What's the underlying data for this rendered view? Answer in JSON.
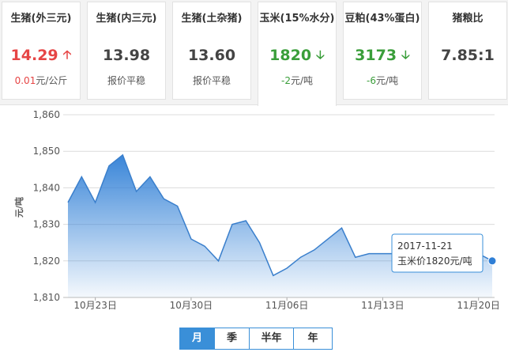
{
  "cards": [
    {
      "title": "生猪(外三元)",
      "price": "14.29",
      "trend": "up",
      "change_amount": "0.01",
      "change_unit": "元/公斤",
      "change_text": ""
    },
    {
      "title": "生猪(内三元)",
      "price": "13.98",
      "trend": "flat",
      "change_amount": "",
      "change_unit": "",
      "change_text": "报价平稳"
    },
    {
      "title": "生猪(土杂猪)",
      "price": "13.60",
      "trend": "flat",
      "change_amount": "",
      "change_unit": "",
      "change_text": "报价平稳"
    },
    {
      "title": "玉米(15%水分)",
      "price": "1820",
      "trend": "down",
      "change_amount": "-2",
      "change_unit": "元/吨",
      "change_text": ""
    },
    {
      "title": "豆粕(43%蛋白)",
      "price": "3173",
      "trend": "down",
      "change_amount": "-6",
      "change_unit": "元/吨",
      "change_text": ""
    },
    {
      "title": "猪粮比",
      "price": "7.85:1",
      "trend": "flat",
      "change_amount": "",
      "change_unit": "",
      "change_text": ""
    }
  ],
  "active_card": 3,
  "colors": {
    "up": "#e64545",
    "down": "#3a9e3a",
    "accent": "#3a8fd8"
  },
  "chart_data": {
    "type": "area",
    "ylabel": "元/吨",
    "ylim": [
      1810,
      1860
    ],
    "yticks": [
      1810,
      1820,
      1830,
      1840,
      1850,
      1860
    ],
    "ytick_labels": [
      "1,810",
      "1,820",
      "1,830",
      "1,840",
      "1,850",
      "1,860"
    ],
    "x": [
      "10-21",
      "10-22",
      "10-23",
      "10-24",
      "10-25",
      "10-26",
      "10-27",
      "10-28",
      "10-29",
      "10-30",
      "10-31",
      "11-01",
      "11-02",
      "11-03",
      "11-04",
      "11-05",
      "11-06",
      "11-07",
      "11-08",
      "11-09",
      "11-10",
      "11-11",
      "11-12",
      "11-13",
      "11-14",
      "11-15",
      "11-16",
      "11-17",
      "11-18",
      "11-19",
      "11-20",
      "11-21"
    ],
    "xtick_labels": [
      {
        "index": 2,
        "label": "10月23日"
      },
      {
        "index": 9,
        "label": "10月30日"
      },
      {
        "index": 16,
        "label": "11月06日"
      },
      {
        "index": 23,
        "label": "11月13日"
      },
      {
        "index": 30,
        "label": "11月20日"
      }
    ],
    "series": [
      {
        "values": [
          1836,
          1843,
          1836,
          1846,
          1849,
          1839,
          1843,
          1837,
          1835,
          1826,
          1824,
          1820,
          1830,
          1831,
          1825,
          1816,
          1818,
          1821,
          1823,
          1826,
          1829,
          1821,
          1822,
          1822,
          1822,
          1822,
          1822,
          1822,
          1822,
          1822,
          1822,
          1820
        ]
      }
    ],
    "grid": true,
    "tooltip": {
      "date": "2017-11-21",
      "label": "玉米价1820元/吨"
    }
  },
  "periods": [
    {
      "label": "月",
      "active": true
    },
    {
      "label": "季",
      "active": false
    },
    {
      "label": "半年",
      "active": false
    },
    {
      "label": "年",
      "active": false
    }
  ]
}
